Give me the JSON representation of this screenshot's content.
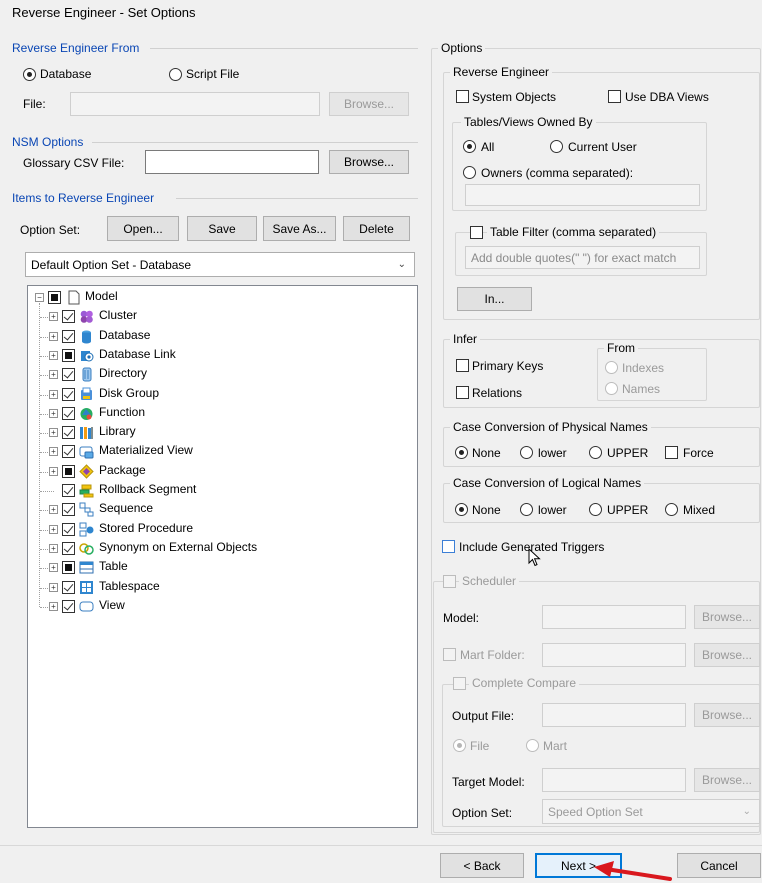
{
  "window": {
    "title": "Reverse Engineer - Set Options"
  },
  "reverse_from": {
    "legend": "Reverse Engineer From",
    "database_label": "Database",
    "script_label": "Script File",
    "file_label": "File:",
    "browse_label": "Browse..."
  },
  "nsm": {
    "legend": "NSM Options",
    "glossary_label": "Glossary CSV File:",
    "browse_label": "Browse..."
  },
  "items": {
    "legend": "Items to Reverse Engineer",
    "option_set_label": "Option Set:",
    "open_label": "Open...",
    "save_label": "Save",
    "save_as_label": "Save As...",
    "delete_label": "Delete",
    "option_set_value": "Default Option Set - Database"
  },
  "tree": {
    "root": "Model",
    "children": [
      {
        "label": "Cluster",
        "state": "checked",
        "icon": "cluster-icon",
        "expandable": true
      },
      {
        "label": "Database",
        "state": "checked",
        "icon": "database-icon",
        "expandable": true
      },
      {
        "label": "Database Link",
        "state": "partial",
        "icon": "database-link-icon",
        "expandable": true
      },
      {
        "label": "Directory",
        "state": "checked",
        "icon": "directory-icon",
        "expandable": true
      },
      {
        "label": "Disk Group",
        "state": "checked",
        "icon": "disk-group-icon",
        "expandable": true
      },
      {
        "label": "Function",
        "state": "checked",
        "icon": "function-icon",
        "expandable": true
      },
      {
        "label": "Library",
        "state": "checked",
        "icon": "library-icon",
        "expandable": true
      },
      {
        "label": "Materialized View",
        "state": "checked",
        "icon": "materialized-view-icon",
        "expandable": true
      },
      {
        "label": "Package",
        "state": "partial",
        "icon": "package-icon",
        "expandable": true
      },
      {
        "label": "Rollback Segment",
        "state": "checked",
        "icon": "rollback-segment-icon",
        "expandable": false
      },
      {
        "label": "Sequence",
        "state": "checked",
        "icon": "sequence-icon",
        "expandable": true
      },
      {
        "label": "Stored Procedure",
        "state": "checked",
        "icon": "stored-procedure-icon",
        "expandable": true
      },
      {
        "label": "Synonym on External Objects",
        "state": "checked",
        "icon": "synonym-icon",
        "expandable": true
      },
      {
        "label": "Table",
        "state": "partial",
        "icon": "table-icon",
        "expandable": true
      },
      {
        "label": "Tablespace",
        "state": "checked",
        "icon": "tablespace-icon",
        "expandable": true
      },
      {
        "label": "View",
        "state": "checked",
        "icon": "view-icon",
        "expandable": true
      }
    ]
  },
  "options": {
    "legend": "Options",
    "re_legend": "Reverse Engineer",
    "system_objects": "System Objects",
    "use_dba_views": "Use DBA Views",
    "owned_legend": "Tables/Views Owned By",
    "all_label": "All",
    "current_user_label": "Current User",
    "owners_label": "Owners (comma separated):",
    "table_filter_label": "Table Filter (comma separated)",
    "table_filter_placeholder": "Add double quotes(\" \") for exact match",
    "in_label": "In..."
  },
  "infer": {
    "legend": "Infer",
    "primary_keys": "Primary Keys",
    "relations": "Relations",
    "from_legend": "From",
    "indexes": "Indexes",
    "names": "Names"
  },
  "case_physical": {
    "legend": "Case Conversion of Physical Names",
    "none": "None",
    "lower": "lower",
    "upper": "UPPER",
    "force": "Force"
  },
  "case_logical": {
    "legend": "Case Conversion of Logical Names",
    "none": "None",
    "lower": "lower",
    "upper": "UPPER",
    "mixed": "Mixed"
  },
  "triggers": {
    "label": "Include Generated Triggers"
  },
  "scheduler": {
    "legend": "Scheduler",
    "model_label": "Model:",
    "browse": "Browse...",
    "mart_folder": "Mart Folder:",
    "complete_compare": "Complete Compare",
    "output_file": "Output File:",
    "file": "File",
    "mart": "Mart",
    "target_model": "Target Model:",
    "option_set": "Option Set:",
    "option_set_value": "Speed Option Set"
  },
  "footer": {
    "back_label": "< Back",
    "next_label": "Next >",
    "cancel_label": "Cancel"
  }
}
